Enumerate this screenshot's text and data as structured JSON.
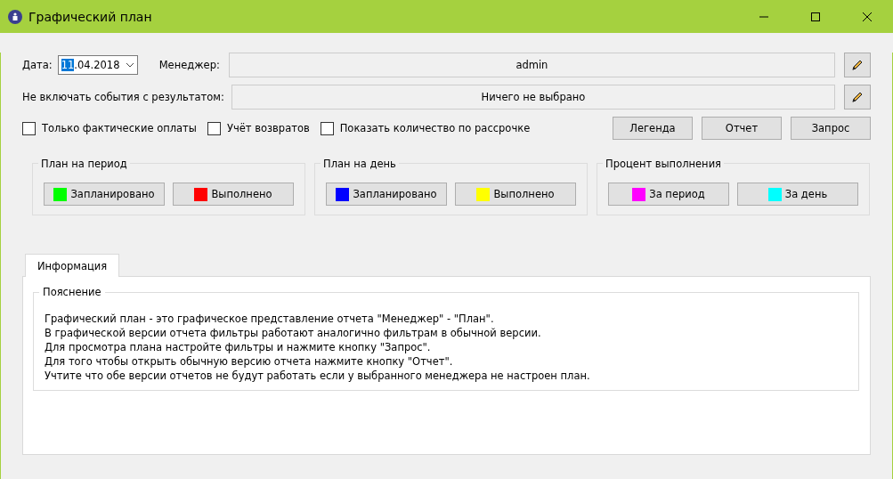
{
  "window": {
    "title": "Графический план"
  },
  "filters": {
    "date_label": "Дата:",
    "date_selected": "11",
    "date_rest": ".04.2018",
    "manager_label": "Менеджер:",
    "manager_value": "admin",
    "exclude_label": "Не включать события с результатом:",
    "exclude_value": "Ничего не выбрано"
  },
  "checkboxes": [
    {
      "label": "Только фактические оплаты",
      "checked": false
    },
    {
      "label": "Учёт возвратов",
      "checked": false
    },
    {
      "label": "Показать количество по рассрочке",
      "checked": false
    }
  ],
  "actions": [
    "Легенда",
    "Отчет",
    "Запрос"
  ],
  "groups": [
    {
      "title": "План на период",
      "buttons": [
        {
          "label": "Запланировано",
          "color": "#00ff00"
        },
        {
          "label": "Выполнено",
          "color": "#ff0000"
        }
      ]
    },
    {
      "title": "План на день",
      "buttons": [
        {
          "label": "Запланировано",
          "color": "#0000ff"
        },
        {
          "label": "Выполнено",
          "color": "#ffff00"
        }
      ]
    },
    {
      "title": "Процент выполнения",
      "buttons": [
        {
          "label": "За период",
          "color": "#ff00ff"
        },
        {
          "label": "За день",
          "color": "#00ffff"
        }
      ]
    }
  ],
  "tabs": [
    {
      "label": "Информация",
      "selected": true
    }
  ],
  "explanation": {
    "title": "Пояснение",
    "lines": [
      "Графический план - это графическое представление отчета \"Менеджер\" - \"План\".",
      "В графической версии отчета фильтры работают аналогично фильтрам в обычной версии.",
      "Для просмотра плана настройте фильтры и нажмите кнопку \"Запрос\".",
      "Для того чтобы открыть обычную версию отчета нажмите кнопку \"Отчет\".",
      "Учтите что обе версии отчетов не будут работать если у выбранного менеджера не настроен план."
    ]
  }
}
